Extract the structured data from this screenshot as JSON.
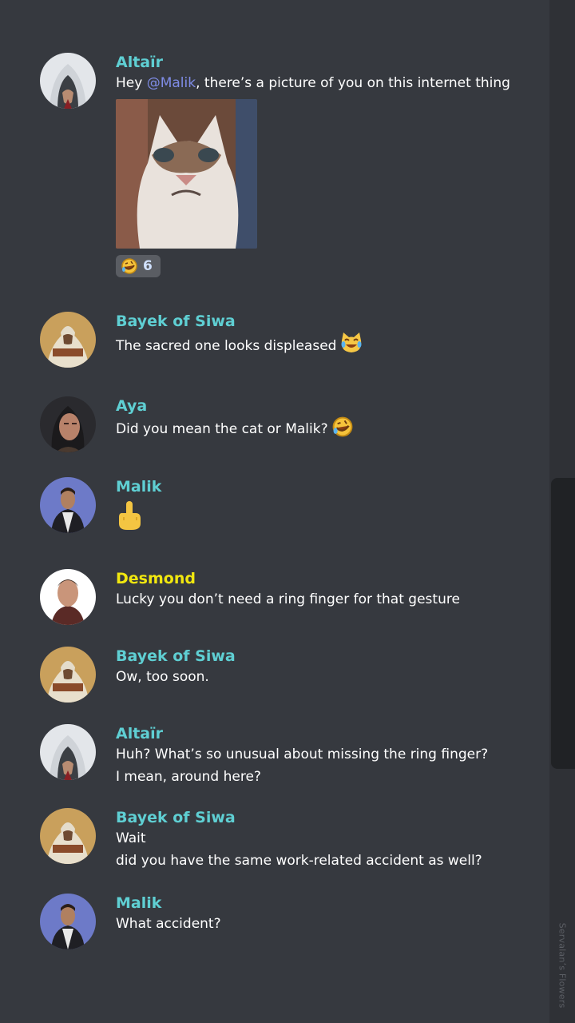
{
  "messages": [
    {
      "author": "Altaïr",
      "lines": [
        {
          "before": "Hey ",
          "mention": "@Malik",
          "after": ", there’s a picture of you on this internet thing"
        }
      ],
      "reaction_count": "6"
    },
    {
      "author": "Bayek of Siwa",
      "lines": [
        "The sacred one looks displeased"
      ]
    },
    {
      "author": "Aya",
      "lines": [
        "Did you mean the cat or Malik?"
      ]
    },
    {
      "author": "Malik",
      "lines": []
    },
    {
      "author": "Desmond",
      "lines": [
        "Lucky you don’t need a ring finger for that gesture"
      ]
    },
    {
      "author": "Bayek of Siwa",
      "lines": [
        "Ow, too soon."
      ]
    },
    {
      "author": "Altaïr",
      "lines": [
        "Huh? What’s so unusual about missing the ring finger?",
        "I mean, around here?"
      ]
    },
    {
      "author": "Bayek of Siwa",
      "lines": [
        "Wait",
        "did you have the same work-related accident as well?"
      ]
    },
    {
      "author": "Malik",
      "lines": [
        "What accident?"
      ]
    }
  ],
  "colors": {
    "background": "#36393f",
    "name": "#5fcfd3",
    "name_highlight": "#f1e70f",
    "mention": "#7f8ce6",
    "text": "#ffffff"
  },
  "watermark": "Servalan’s Flowers"
}
